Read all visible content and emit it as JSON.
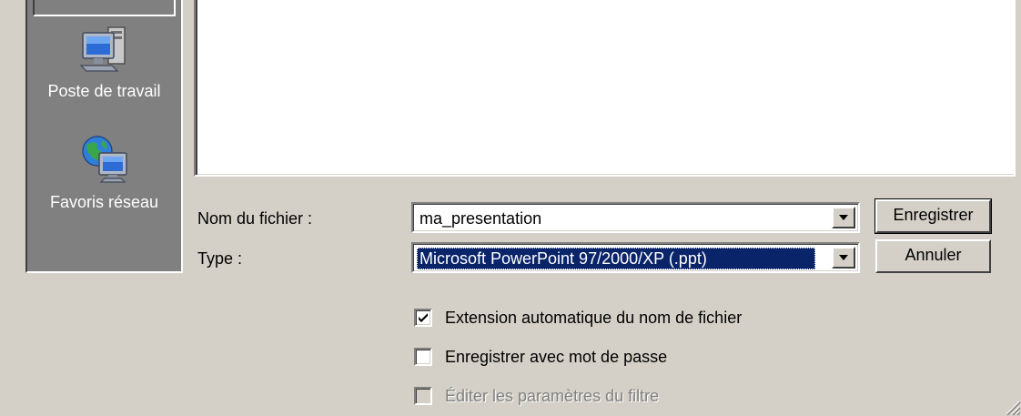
{
  "places": [
    {
      "label": "Poste de travail",
      "icon": "my-computer-icon"
    },
    {
      "label": "Favoris réseau",
      "icon": "network-places-icon"
    }
  ],
  "form": {
    "filename_label": "Nom du fichier :",
    "filename_value": "ma_presentation",
    "type_label": "Type :",
    "type_value": "Microsoft PowerPoint 97/2000/XP (.ppt)"
  },
  "buttons": {
    "save": "Enregistrer",
    "cancel": "Annuler"
  },
  "options": [
    {
      "label": "Extension automatique du nom de fichier",
      "checked": true,
      "enabled": true
    },
    {
      "label": "Enregistrer avec mot de passe",
      "checked": false,
      "enabled": true
    },
    {
      "label": "Éditer les paramètres du filtre",
      "checked": false,
      "enabled": false
    }
  ],
  "colors": {
    "dialog_bg": "#d4d0c8",
    "places_bg": "#808080",
    "selection_bg": "#0a246a",
    "disabled_text": "#808080"
  }
}
